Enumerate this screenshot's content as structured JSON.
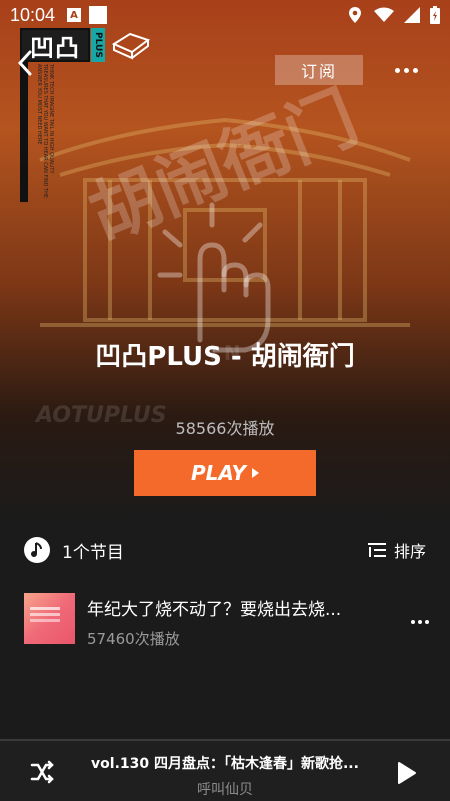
{
  "status_bar": {
    "time": "10:04",
    "notif_badge": "A"
  },
  "header": {
    "logo_text": "凹凸",
    "logo_plus": "PLUS",
    "logo_side_text": "THINK TECH IMAGINE TAIL IN HIGH QUALITY TREASURES THAT YOU WANT TO HEAR CAN FIND THE ANSWER YOU MOST NEED HERE",
    "subscribe_label": "订阅"
  },
  "hero": {
    "art_text": "胡闹衙门",
    "title": "凹凸PLUS - 胡闹衙门",
    "brand_faded": "AOTUPLUS",
    "play_count": "58566次播放",
    "play_label": "PLAY"
  },
  "list": {
    "episode_count": "1个节目",
    "sort_label": "排序",
    "episodes": [
      {
        "title": "年纪大了烧不动了？要烧出去烧...",
        "plays": "57460次播放"
      }
    ]
  },
  "mini_player": {
    "title": "vol.130 四月盘点：「枯木逢春」新歌抢...",
    "artist": "呼叫仙贝"
  },
  "colors": {
    "accent": "#f46a2b",
    "hero_top": "#a8401a",
    "background": "#1b1b1b"
  }
}
